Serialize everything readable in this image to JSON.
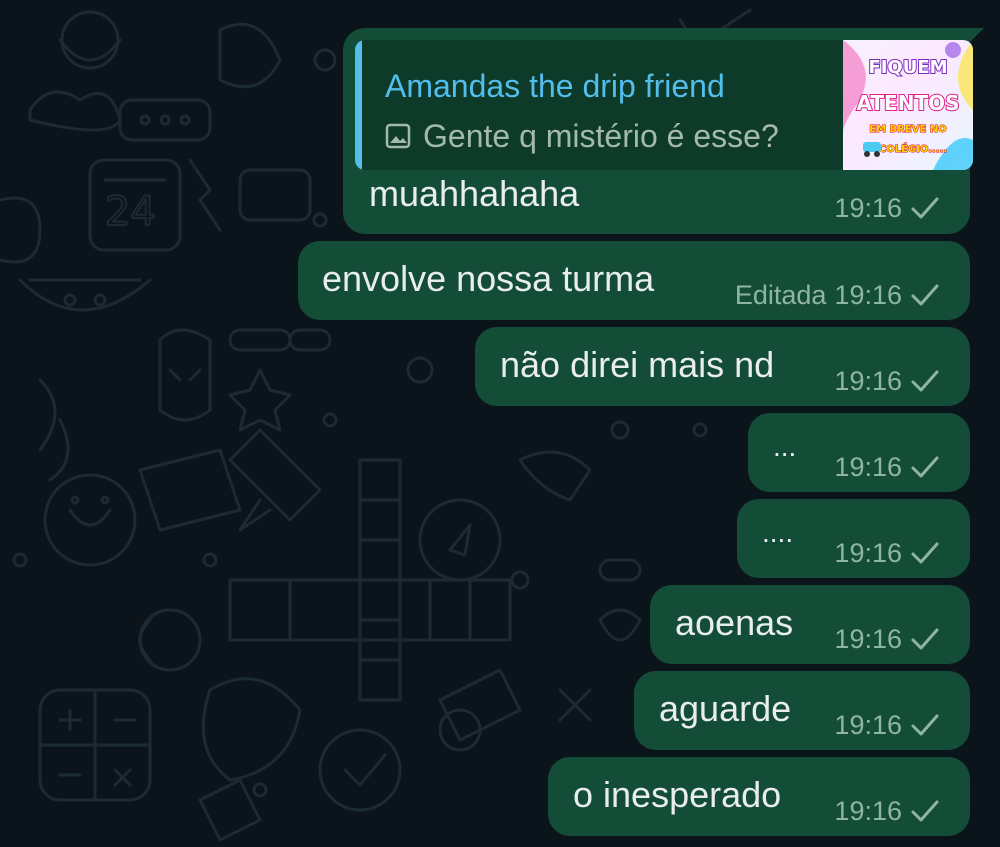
{
  "reply": {
    "author": "Amandas the drip friend",
    "text": "Gente q mistério é esse?",
    "thumbnail": {
      "line1": "FIQUEM",
      "line2": "ATENTOS",
      "line3": "EM BREVE NO",
      "line4": "COLÉGIO....."
    }
  },
  "messages": [
    {
      "text": "muahhahaha",
      "edited": "",
      "time": "19:16",
      "status_icon": "single-check-icon"
    },
    {
      "text": "envolve nossa turma",
      "edited": "Editada",
      "time": "19:16",
      "status_icon": "single-check-icon"
    },
    {
      "text": "não direi mais nd",
      "edited": "",
      "time": "19:16",
      "status_icon": "single-check-icon"
    },
    {
      "text": "...",
      "edited": "",
      "time": "19:16",
      "status_icon": "single-check-icon"
    },
    {
      "text": "....",
      "edited": "",
      "time": "19:16",
      "status_icon": "single-check-icon"
    },
    {
      "text": "aoenas",
      "edited": "",
      "time": "19:16",
      "status_icon": "single-check-icon"
    },
    {
      "text": "aguarde",
      "edited": "",
      "time": "19:16",
      "status_icon": "single-check-icon"
    },
    {
      "text": "o inesperado",
      "edited": "",
      "time": "19:16",
      "status_icon": "single-check-icon"
    }
  ],
  "colors": {
    "background": "#0b141a",
    "outgoing_bubble": "#144d37",
    "quote_accent": "#53bdeb",
    "text": "#e9edef",
    "meta": "#8fb5a2"
  }
}
